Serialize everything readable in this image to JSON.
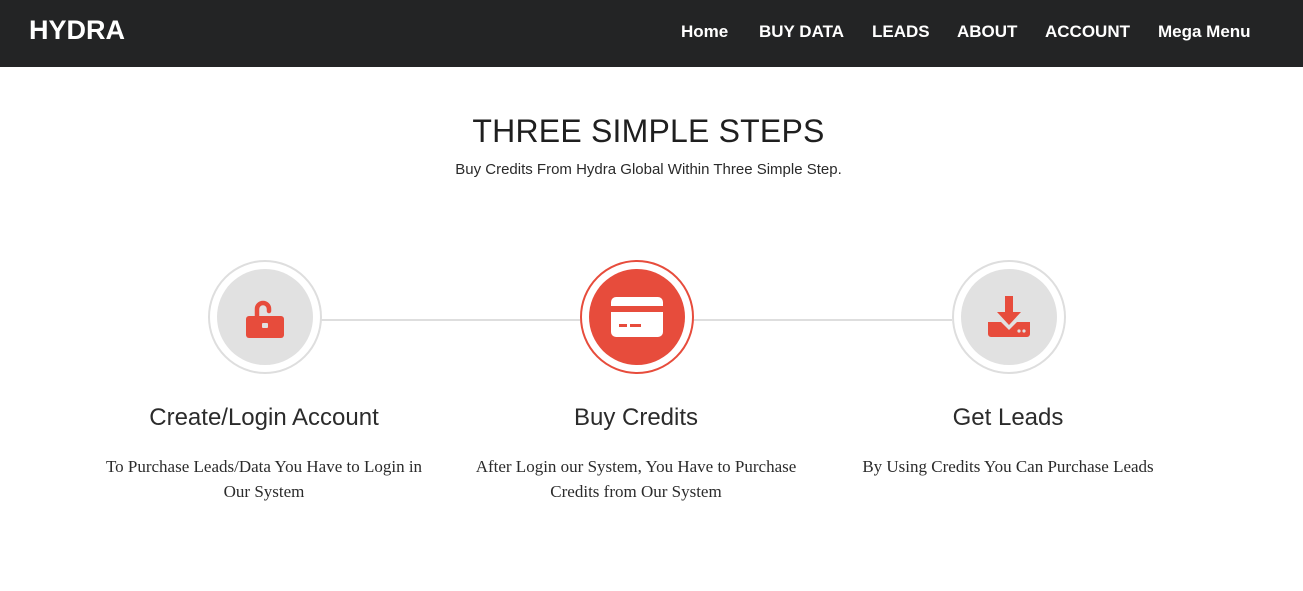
{
  "brand": "HYDRA",
  "nav": {
    "items": [
      "Home",
      "BUY DATA",
      "LEADS",
      "ABOUT",
      "ACCOUNT",
      "Mega Menu"
    ]
  },
  "section": {
    "title": "THREE SIMPLE STEPS",
    "subtitle": "Buy Credits From Hydra Global Within Three Simple Step."
  },
  "steps": [
    {
      "icon": "unlock-icon",
      "title": "Create/Login Account",
      "desc_line1": "To Purchase Leads/Data You Have to Login in",
      "desc_line2": "Our System",
      "active": false
    },
    {
      "icon": "credit-card-icon",
      "title": "Buy Credits",
      "desc_line1": "After Login our System, You Have to Purchase",
      "desc_line2": "Credits from Our System",
      "active": true
    },
    {
      "icon": "download-icon",
      "title": "Get Leads",
      "desc_line1": "By Using Credits You Can Purchase Leads",
      "desc_line2": "",
      "active": false
    }
  ],
  "colors": {
    "navbar": "#232425",
    "accent": "#e74c3c",
    "inactive_circle": "#e1e1e1",
    "connector": "#dedede"
  }
}
